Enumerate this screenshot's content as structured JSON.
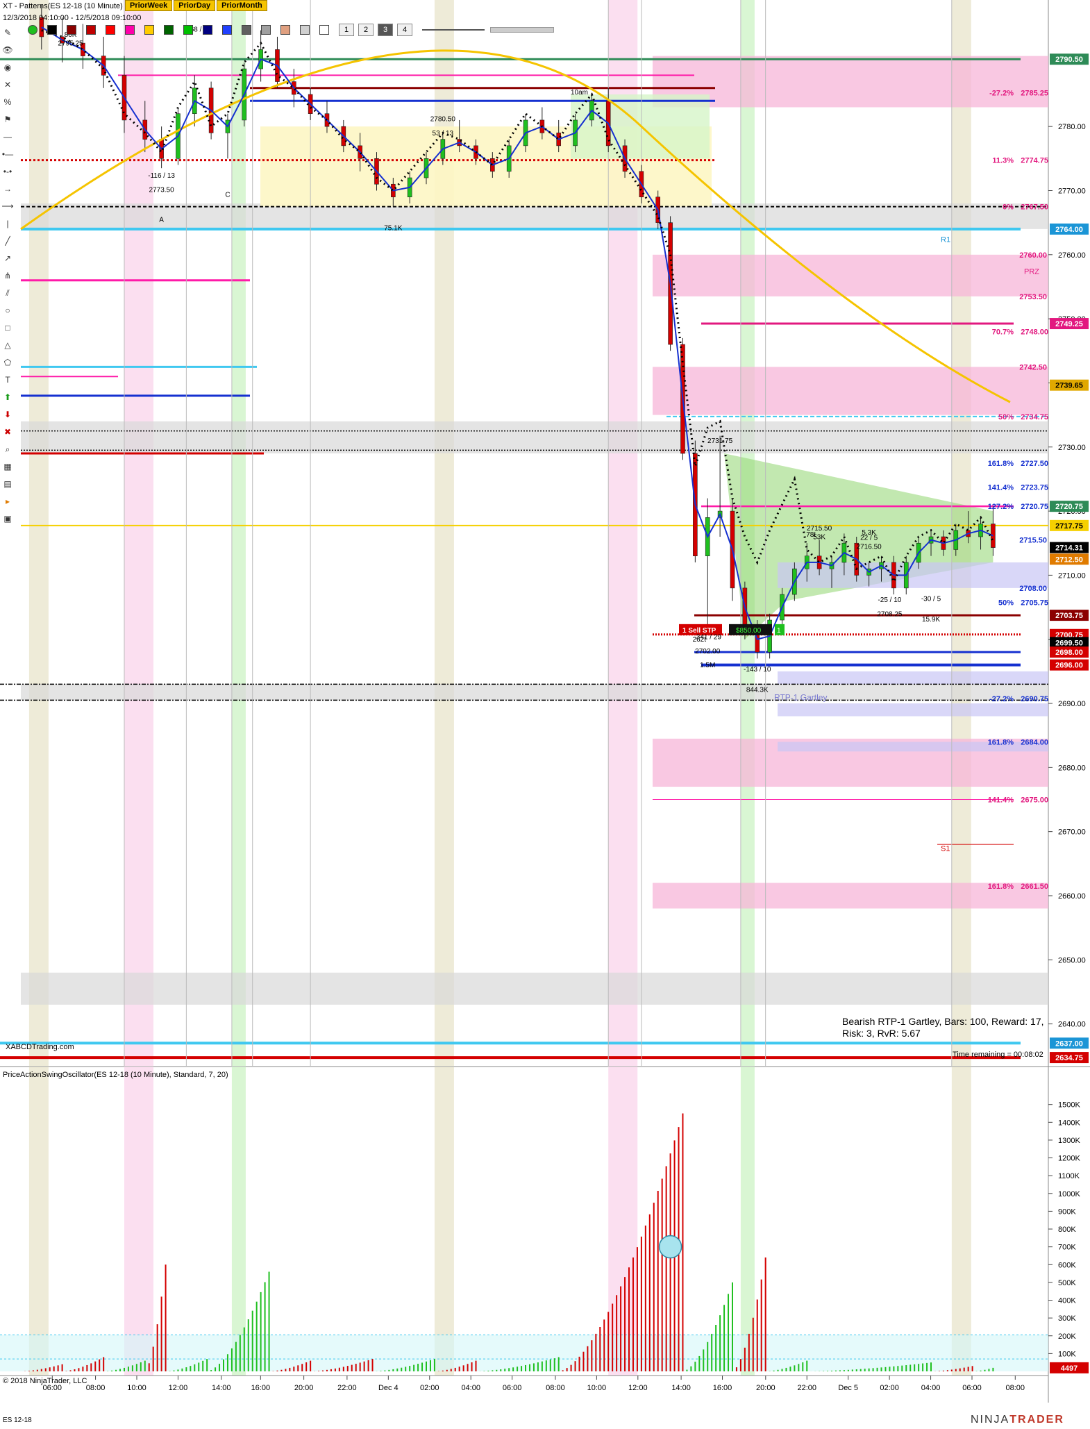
{
  "window": {
    "title": "XT - Patterns(ES 12-18 (10 Minute)",
    "date_range": "12/3/2018 04:10:00 - 12/5/2018 09:10:00",
    "tabs": [
      "PriorWeek",
      "PriorDay",
      "PriorMonth"
    ],
    "bar_width_buttons": [
      "1",
      "2",
      "3",
      "4"
    ],
    "selected_width": "3"
  },
  "pattern_box": {
    "line1": "Bearish RTP-1 Gartley, Bars: 100, Reward: 17,",
    "line2": "Risk: 3, RvR: 5.67"
  },
  "branding": {
    "left": "XABCDTrading.com",
    "copyright": "© 2018 NinjaTrader, LLC",
    "logo_a": "NINJA",
    "logo_b": "TRADER"
  },
  "time_remaining": "Time remaining = 00:08:02",
  "instrument": "ES 12-18",
  "oscillator_title": "PriceActionSwingOscillator(ES 12-18 (10 Minute), Standard, 7, 20)",
  "order": {
    "label": "1  Sell STP",
    "pnl": "$850.00",
    "qty": "1"
  },
  "colors": {
    "bull": "#1fbf1f",
    "bear": "#d40000",
    "ema_blue": "#1530d0",
    "gold": "#f5c400",
    "pink_zone": "#f7b6d8",
    "magenta": "#ff1aa8",
    "cyan": "#3fc8f0",
    "bg": "#ffffff"
  },
  "chart_data": {
    "type": "candlestick",
    "price_axis": {
      "range": [
        2634,
        2798
      ],
      "ticks": [
        "2640.00",
        "2650.00",
        "2660.00",
        "2670.00",
        "2680.00",
        "2690.00",
        "2700.00",
        "2710.00",
        "2720.00",
        "2730.00",
        "2740.00",
        "2750.00",
        "2760.00",
        "2770.00",
        "2780.00"
      ]
    },
    "time_axis": {
      "labels": [
        "06:00",
        "08:00",
        "10:00",
        "12:00",
        "14:00",
        "16:00",
        "20:00",
        "22:00",
        "Dec 4",
        "02:00",
        "04:00",
        "06:00",
        "08:00",
        "10:00",
        "12:00",
        "14:00",
        "16:00",
        "20:00",
        "22:00",
        "Dec 5",
        "02:00",
        "04:00",
        "06:00",
        "08:00"
      ]
    },
    "price_labels": [
      {
        "text": "2790.50",
        "color": "#2e8b57"
      },
      {
        "text": "2764.00",
        "color": "#1b95d6"
      },
      {
        "text": "2749.25",
        "color": "#e2187f"
      },
      {
        "text": "2739.65",
        "color": "#e0a800"
      },
      {
        "text": "2720.75",
        "color": "#2e8b57"
      },
      {
        "text": "2717.75",
        "color": "#f5d000"
      },
      {
        "text": "2714.31",
        "color": "#000000"
      },
      {
        "text": "2712.50",
        "color": "#e07b00"
      },
      {
        "text": "2703.75",
        "color": "#8b0000"
      },
      {
        "text": "2700.75",
        "color": "#d40000"
      },
      {
        "text": "2699.50",
        "color": "#000000"
      },
      {
        "text": "2698.00",
        "color": "#d40000"
      },
      {
        "text": "2696.00",
        "color": "#d40000"
      },
      {
        "text": "2637.00",
        "color": "#1b95d6"
      },
      {
        "text": "2634.75",
        "color": "#d40000"
      }
    ],
    "fib_levels": [
      {
        "pct": "-27.2%",
        "price": "2785.25",
        "color": "#e2187f"
      },
      {
        "pct": "11.3%",
        "price": "2774.75",
        "color": "#e2187f"
      },
      {
        "pct": "0%",
        "price": "2767.50",
        "color": "#e2187f"
      },
      {
        "pct": "70.7%",
        "price": "2748.00",
        "color": "#e2187f"
      },
      {
        "pct": "50%",
        "price": "2734.75",
        "color": "#e2187f"
      },
      {
        "pct": "161.8%",
        "price": "2727.50",
        "color": "#1530d0"
      },
      {
        "pct": "141.4%",
        "price": "2723.75",
        "color": "#1530d0"
      },
      {
        "pct": "127.2%",
        "price": "2720.75",
        "color": "#1530d0"
      },
      {
        "pct": "50%",
        "price": "2705.75",
        "color": "#1530d0"
      },
      {
        "pct": "-27.2%",
        "price": "2690.75",
        "color": "#1530d0"
      },
      {
        "pct": "161.8%",
        "price": "2684.00",
        "color": "#1530d0"
      },
      {
        "pct": "141.4%",
        "price": "2675.00",
        "color": "#e2187f"
      },
      {
        "pct": "161.8%",
        "price": "2661.50",
        "color": "#e2187f"
      }
    ],
    "zone_prices": [
      "2760.00",
      "2753.50",
      "2742.50",
      "2715.50",
      "2708.00"
    ],
    "zone_labels": [
      "PRZ",
      "R1",
      "S1",
      "RTP-1 Gartley"
    ],
    "swing_labels": [
      {
        "text": "-116 / 13"
      },
      {
        "text": "2773.50"
      },
      {
        "text": "A"
      },
      {
        "text": "C"
      },
      {
        "text": "2780.50"
      },
      {
        "text": "53 / 13"
      },
      {
        "text": "10am"
      },
      {
        "text": "75.1K"
      },
      {
        "text": "2731.75"
      },
      {
        "text": "-341 / 29"
      },
      {
        "text": "2702.00"
      },
      {
        "text": "1.5M"
      },
      {
        "text": "-143 / 10"
      },
      {
        "text": "844.3K"
      },
      {
        "text": "53K"
      },
      {
        "text": "2715.50"
      },
      {
        "text": "5.3K"
      },
      {
        "text": "2716.50"
      },
      {
        "text": "22 / 5"
      },
      {
        "text": "-25 / 10"
      },
      {
        "text": "2708.25"
      },
      {
        "text": "-30 / 5"
      },
      {
        "text": "15.9K"
      },
      {
        "text": "2795.25"
      },
      {
        "text": "86K"
      },
      {
        "text": "68 / 5"
      },
      {
        "text": "262t"
      },
      {
        "text": "78t"
      }
    ],
    "candles": [
      {
        "t": 0.5,
        "o": 2797,
        "h": 2799,
        "l": 2792,
        "c": 2794
      },
      {
        "t": 1,
        "o": 2794,
        "h": 2797,
        "l": 2790,
        "c": 2793
      },
      {
        "t": 1.5,
        "o": 2793,
        "h": 2796,
        "l": 2789,
        "c": 2791
      },
      {
        "t": 2,
        "o": 2791,
        "h": 2794,
        "l": 2786,
        "c": 2788
      },
      {
        "t": 2.5,
        "o": 2788,
        "h": 2791,
        "l": 2779,
        "c": 2781
      },
      {
        "t": 3,
        "o": 2781,
        "h": 2784,
        "l": 2776,
        "c": 2778
      },
      {
        "t": 3.4,
        "o": 2778,
        "h": 2780,
        "l": 2773.5,
        "c": 2775
      },
      {
        "t": 3.8,
        "o": 2775,
        "h": 2783,
        "l": 2774,
        "c": 2782
      },
      {
        "t": 4.2,
        "o": 2782,
        "h": 2788,
        "l": 2780,
        "c": 2786
      },
      {
        "t": 4.6,
        "o": 2786,
        "h": 2787,
        "l": 2778,
        "c": 2779
      },
      {
        "t": 5,
        "o": 2779,
        "h": 2782,
        "l": 2775,
        "c": 2781
      },
      {
        "t": 5.4,
        "o": 2781,
        "h": 2790,
        "l": 2780,
        "c": 2789
      },
      {
        "t": 5.8,
        "o": 2789,
        "h": 2795,
        "l": 2787,
        "c": 2792
      },
      {
        "t": 6.2,
        "o": 2792,
        "h": 2794,
        "l": 2786,
        "c": 2787
      },
      {
        "t": 6.6,
        "o": 2787,
        "h": 2789,
        "l": 2783,
        "c": 2785
      },
      {
        "t": 7,
        "o": 2785,
        "h": 2786,
        "l": 2781,
        "c": 2782
      },
      {
        "t": 7.4,
        "o": 2782,
        "h": 2784,
        "l": 2779,
        "c": 2780
      },
      {
        "t": 7.8,
        "o": 2780,
        "h": 2781,
        "l": 2776,
        "c": 2777
      },
      {
        "t": 8.2,
        "o": 2777,
        "h": 2779,
        "l": 2773,
        "c": 2775
      },
      {
        "t": 8.6,
        "o": 2775,
        "h": 2776,
        "l": 2770,
        "c": 2771
      },
      {
        "t": 9,
        "o": 2771,
        "h": 2772,
        "l": 2767.5,
        "c": 2769
      },
      {
        "t": 9.4,
        "o": 2769,
        "h": 2773,
        "l": 2768,
        "c": 2772
      },
      {
        "t": 9.8,
        "o": 2772,
        "h": 2776,
        "l": 2771,
        "c": 2775
      },
      {
        "t": 10.2,
        "o": 2775,
        "h": 2779,
        "l": 2774,
        "c": 2778
      },
      {
        "t": 10.6,
        "o": 2778,
        "h": 2781,
        "l": 2776,
        "c": 2777
      },
      {
        "t": 11,
        "o": 2777,
        "h": 2778,
        "l": 2774,
        "c": 2775
      },
      {
        "t": 11.4,
        "o": 2775,
        "h": 2776,
        "l": 2772,
        "c": 2773
      },
      {
        "t": 11.8,
        "o": 2773,
        "h": 2778,
        "l": 2772,
        "c": 2777
      },
      {
        "t": 12.2,
        "o": 2777,
        "h": 2782,
        "l": 2776,
        "c": 2781
      },
      {
        "t": 12.6,
        "o": 2781,
        "h": 2783,
        "l": 2778,
        "c": 2779
      },
      {
        "t": 13,
        "o": 2779,
        "h": 2781,
        "l": 2776,
        "c": 2777
      },
      {
        "t": 13.4,
        "o": 2777,
        "h": 2782,
        "l": 2776,
        "c": 2781
      },
      {
        "t": 13.8,
        "o": 2781,
        "h": 2785,
        "l": 2780,
        "c": 2784
      },
      {
        "t": 14.2,
        "o": 2784,
        "h": 2786,
        "l": 2776,
        "c": 2777
      },
      {
        "t": 14.6,
        "o": 2777,
        "h": 2778,
        "l": 2772,
        "c": 2773
      },
      {
        "t": 15,
        "o": 2773,
        "h": 2774,
        "l": 2768,
        "c": 2769
      },
      {
        "t": 15.4,
        "o": 2769,
        "h": 2770,
        "l": 2764,
        "c": 2765
      },
      {
        "t": 15.7,
        "o": 2765,
        "h": 2766,
        "l": 2745,
        "c": 2746
      },
      {
        "t": 16,
        "o": 2746,
        "h": 2747,
        "l": 2728,
        "c": 2729
      },
      {
        "t": 16.3,
        "o": 2729,
        "h": 2731,
        "l": 2712,
        "c": 2713
      },
      {
        "t": 16.6,
        "o": 2713,
        "h": 2722,
        "l": 2702,
        "c": 2719
      },
      {
        "t": 16.9,
        "o": 2719,
        "h": 2731.75,
        "l": 2716,
        "c": 2720
      },
      {
        "t": 17.2,
        "o": 2720,
        "h": 2722,
        "l": 2706,
        "c": 2708
      },
      {
        "t": 17.5,
        "o": 2708,
        "h": 2709,
        "l": 2700,
        "c": 2702
      },
      {
        "t": 17.8,
        "o": 2702,
        "h": 2703,
        "l": 2697,
        "c": 2698
      },
      {
        "t": 18.1,
        "o": 2698,
        "h": 2704,
        "l": 2697,
        "c": 2703
      },
      {
        "t": 18.4,
        "o": 2703,
        "h": 2708,
        "l": 2702,
        "c": 2707
      },
      {
        "t": 18.7,
        "o": 2707,
        "h": 2712,
        "l": 2706,
        "c": 2711
      },
      {
        "t": 19,
        "o": 2711,
        "h": 2715,
        "l": 2709,
        "c": 2713
      },
      {
        "t": 19.3,
        "o": 2713,
        "h": 2715.5,
        "l": 2710,
        "c": 2711
      },
      {
        "t": 19.6,
        "o": 2711,
        "h": 2713,
        "l": 2708,
        "c": 2712
      },
      {
        "t": 19.9,
        "o": 2712,
        "h": 2716.5,
        "l": 2710,
        "c": 2715
      },
      {
        "t": 20.2,
        "o": 2715,
        "h": 2716,
        "l": 2709,
        "c": 2710
      },
      {
        "t": 20.5,
        "o": 2710,
        "h": 2712,
        "l": 2708.25,
        "c": 2711
      },
      {
        "t": 20.8,
        "o": 2711,
        "h": 2713,
        "l": 2709,
        "c": 2712
      },
      {
        "t": 21.1,
        "o": 2712,
        "h": 2713,
        "l": 2707,
        "c": 2708
      },
      {
        "t": 21.4,
        "o": 2708,
        "h": 2713,
        "l": 2707,
        "c": 2712
      },
      {
        "t": 21.7,
        "o": 2712,
        "h": 2716,
        "l": 2711,
        "c": 2715
      },
      {
        "t": 22,
        "o": 2715,
        "h": 2717,
        "l": 2713,
        "c": 2716
      },
      {
        "t": 22.3,
        "o": 2716,
        "h": 2717,
        "l": 2713,
        "c": 2714
      },
      {
        "t": 22.6,
        "o": 2714,
        "h": 2718,
        "l": 2713,
        "c": 2717
      },
      {
        "t": 22.9,
        "o": 2717,
        "h": 2720,
        "l": 2715,
        "c": 2716
      },
      {
        "t": 23.2,
        "o": 2716,
        "h": 2719,
        "l": 2714,
        "c": 2718
      },
      {
        "t": 23.5,
        "o": 2718,
        "h": 2720.75,
        "l": 2713,
        "c": 2714.31
      }
    ],
    "oscillator": {
      "axis_ticks": [
        "100K",
        "200K",
        "300K",
        "400K",
        "500K",
        "600K",
        "700K",
        "800K",
        "900K",
        "1000K",
        "1100K",
        "1200K",
        "1300K",
        "1400K",
        "1500K"
      ],
      "last_value": "4497",
      "bars": [
        {
          "t": 1,
          "v": 40,
          "c": "bear"
        },
        {
          "t": 2,
          "v": 80,
          "c": "bear"
        },
        {
          "t": 3,
          "v": 60,
          "c": "bull"
        },
        {
          "t": 3.5,
          "v": 600,
          "c": "bear"
        },
        {
          "t": 4.5,
          "v": 70,
          "c": "bull"
        },
        {
          "t": 6,
          "v": 560,
          "c": "bull"
        },
        {
          "t": 7,
          "v": 60,
          "c": "bear"
        },
        {
          "t": 8.5,
          "v": 70,
          "c": "bear"
        },
        {
          "t": 10,
          "v": 70,
          "c": "bull"
        },
        {
          "t": 11,
          "v": 60,
          "c": "bear"
        },
        {
          "t": 13,
          "v": 80,
          "c": "bull"
        },
        {
          "t": 16,
          "v": 1450,
          "c": "bear"
        },
        {
          "t": 17.2,
          "v": 500,
          "c": "bull"
        },
        {
          "t": 18,
          "v": 640,
          "c": "bear"
        },
        {
          "t": 19,
          "v": 60,
          "c": "bull"
        },
        {
          "t": 22,
          "v": 50,
          "c": "bull"
        },
        {
          "t": 23,
          "v": 30,
          "c": "bear"
        },
        {
          "t": 23.5,
          "v": 20,
          "c": "bull"
        }
      ]
    }
  }
}
